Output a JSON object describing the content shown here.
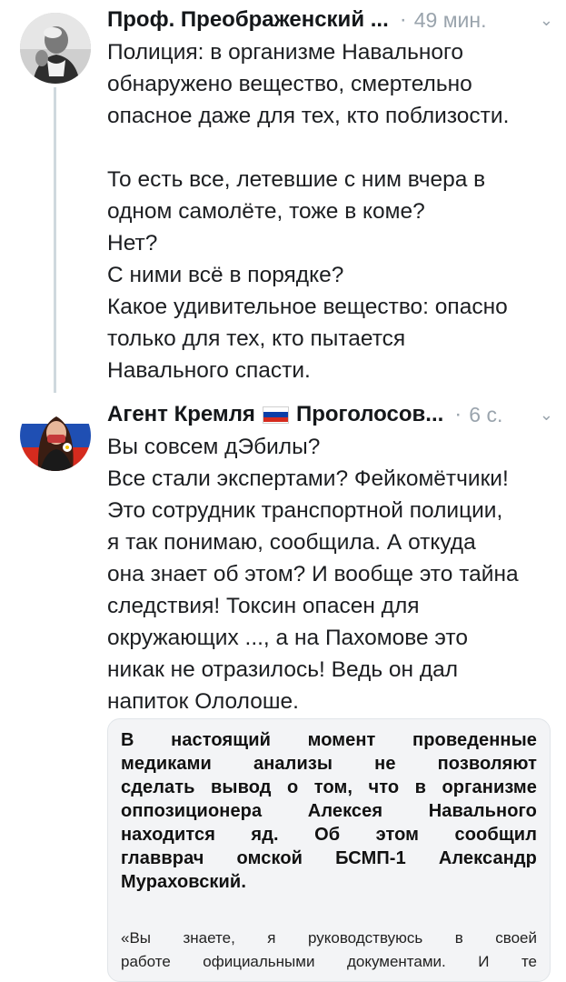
{
  "tweets": [
    {
      "author_name": "Проф. Преображенский ...",
      "time": "49 мин.",
      "avatar_icon": "bw-portrait-avatar",
      "lines": [
        "Полиция: в организме Навального",
        "обнаружено вещество, смертельно",
        "опасное даже для тех, кто поблизости.",
        "",
        "То есть все, летевшие с ним вчера в",
        "одном самолёте, тоже в коме?",
        "Нет?",
        "С ними всё в порядке?",
        "Какое удивительное вещество: опасно",
        "только для тех, кто пытается",
        "Навального спасти."
      ]
    },
    {
      "author_name_part1": "Агент Кремля",
      "author_name_part2": "Проголосов...",
      "time": "6 с.",
      "avatar_icon": "woman-flag-avatar",
      "flag_icon": "russia-flag-icon",
      "lines": [
        "Вы совсем дЭбилы?",
        "Все стали экспертами? Фейкомётчики!",
        "Это сотрудник транспортной полиции,",
        "я так понимаю, сообщила. А откуда",
        "она знает об этом? И вообще это тайна",
        "следствия! Токсин опасен для",
        "окружающих ..., а на Пахомове это",
        "никак не отразилось! Ведь он дал",
        "напиток Ололоше."
      ],
      "quote": {
        "bold_lines": [
          "В настоящий момент проведенные",
          "медиками анализы не позволяют",
          "сделать вывод о том, что в организме",
          "оппозиционера Алексея Навального",
          "находится яд. Об этом сообщил",
          "главврач омской БСМП-1 Александр",
          "Мураховский."
        ],
        "regular_lines": [
          "«Вы знаете, я руководствуюсь в своей",
          "работе официальными документами. И те"
        ]
      }
    }
  ],
  "colors": {
    "text": "#1c1e21",
    "muted": "#9aa4ad",
    "thread_line": "#cfd9de",
    "quote_bg": "#f3f4f6"
  }
}
